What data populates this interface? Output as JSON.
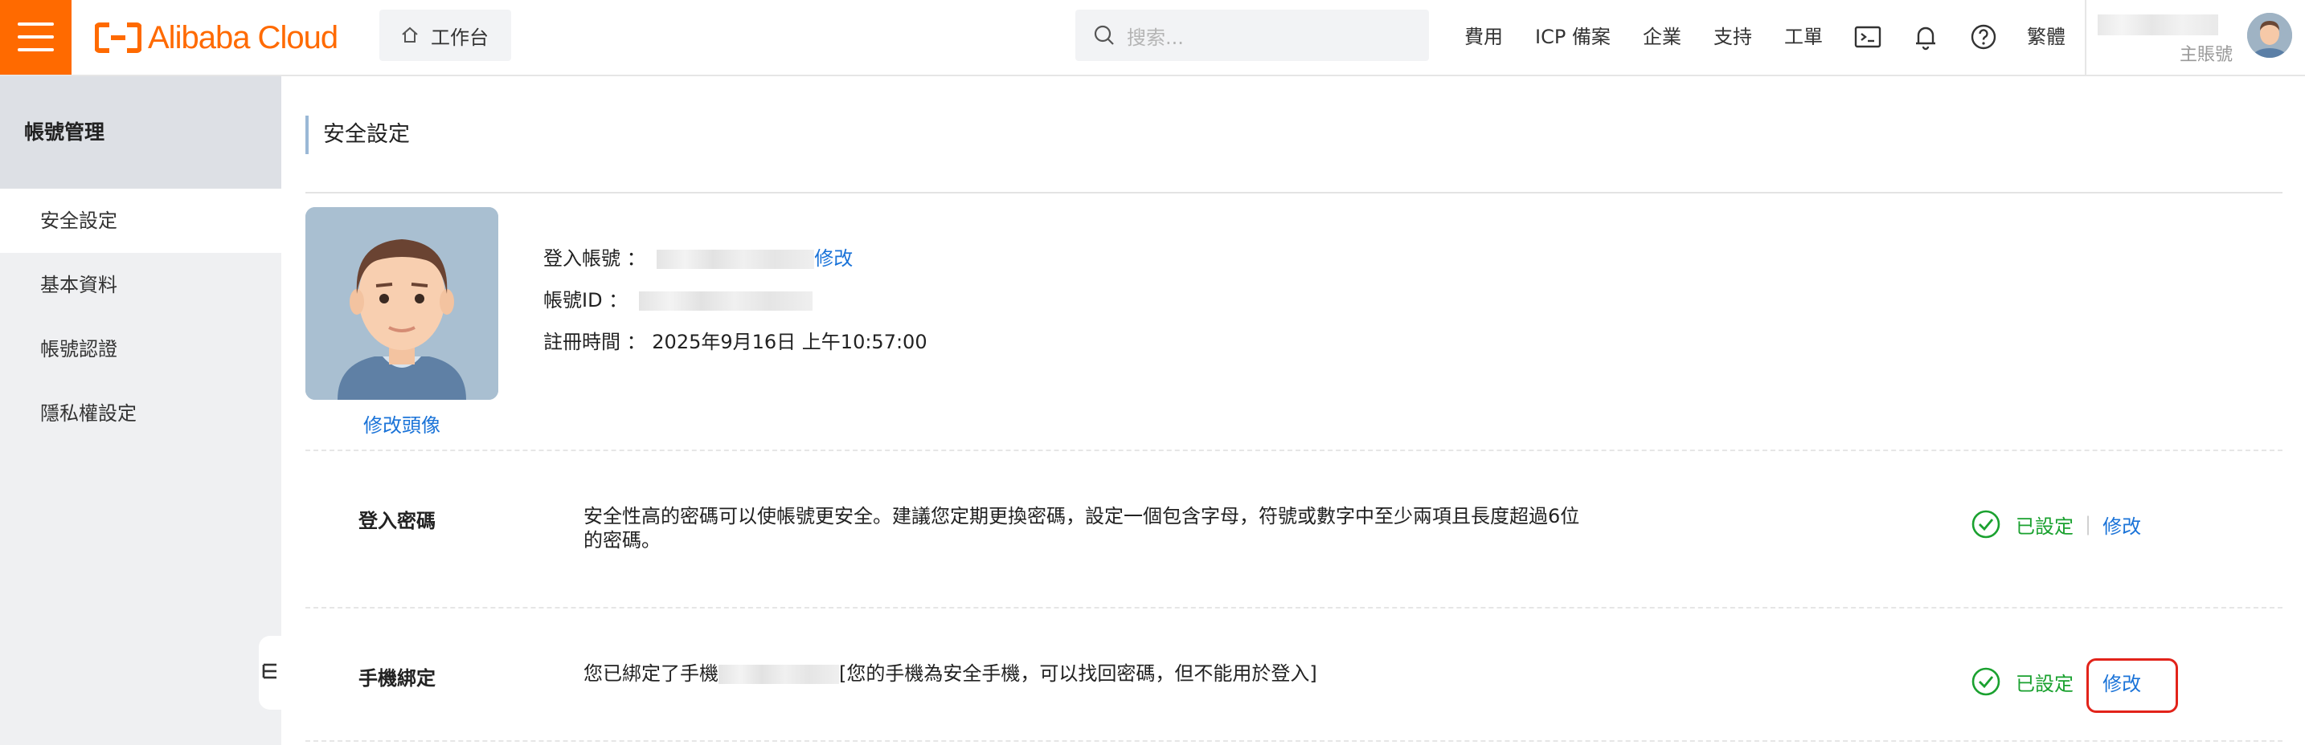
{
  "topbar": {
    "brand": "Alibaba Cloud",
    "workbench_label": "工作台",
    "search_placeholder": "搜索...",
    "nav": {
      "billing": "費用",
      "icp": "ICP 備案",
      "enterprise": "企業",
      "support": "支持",
      "ticket": "工單",
      "language": "繁體"
    },
    "user_role": "主賬號",
    "icons": [
      "menu-icon",
      "home-icon",
      "search-icon",
      "terminal-icon",
      "bell-icon",
      "help-icon"
    ]
  },
  "sidebar": {
    "title": "帳號管理",
    "items": [
      {
        "label": "安全設定",
        "active": true
      },
      {
        "label": "基本資料",
        "active": false
      },
      {
        "label": "帳號認證",
        "active": false
      },
      {
        "label": "隱私權設定",
        "active": false
      }
    ]
  },
  "main": {
    "page_title": "安全設定",
    "avatar_link": "修改頭像",
    "profile": {
      "login_account_label": "登入帳號 ：",
      "login_account_edit": "修改",
      "account_id_label": "帳號ID ：",
      "register_time_label": "註冊時間 ：",
      "register_time_value": "2025年9月16日 上午10:57:00"
    },
    "sections": [
      {
        "label": "登入密碼",
        "description": "安全性高的密碼可以使帳號更安全。建議您定期更換密碼，設定一個包含字母，符號或數字中至少兩項且長度超過6位的密碼。",
        "status": "已設定",
        "action": "修改"
      },
      {
        "label": "手機綁定",
        "description_prefix": "您已綁定了手機",
        "description_suffix": "[您的手機為安全手機，可以找回密碼，但不能用於登入]",
        "status": "已設定",
        "action": "修改"
      }
    ]
  },
  "colors": {
    "brand_orange": "#ff6a00",
    "link_blue": "#1a73d8",
    "success_green": "#1aa12f",
    "highlight_red": "#e2231a"
  }
}
